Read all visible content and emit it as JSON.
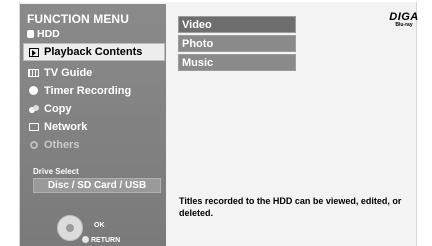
{
  "menu": {
    "title": "FUNCTION MENU",
    "device": "HDD",
    "items": [
      {
        "label": "Playback Contents",
        "icon": "playback-icon",
        "state": "selected"
      },
      {
        "label": "TV Guide",
        "icon": "tv-guide-icon",
        "state": "normal"
      },
      {
        "label": "Timer Recording",
        "icon": "clock-icon",
        "state": "normal"
      },
      {
        "label": "Copy",
        "icon": "copy-icon",
        "state": "normal"
      },
      {
        "label": "Network",
        "icon": "network-icon",
        "state": "normal"
      },
      {
        "label": "Others",
        "icon": "others-icon",
        "state": "disabled"
      }
    ],
    "drive_select_label": "Drive Select",
    "drive_button": "Disc / SD Card / USB",
    "ok_label": "OK",
    "return_label": "RETURN"
  },
  "submenu": {
    "items": [
      {
        "label": "Video",
        "state": "selected"
      },
      {
        "label": "Photo",
        "state": "normal"
      },
      {
        "label": "Music",
        "state": "normal"
      }
    ]
  },
  "logo": {
    "main": "DIGA",
    "sub": "Blu-ray"
  },
  "description": "Titles recorded to the HDD can be viewed, edited, or deleted.",
  "colors": {
    "panel": "#808080",
    "selected": "#ededed",
    "submenu": "#8a8a8a",
    "submenu_selected": "#6e6e6e"
  }
}
